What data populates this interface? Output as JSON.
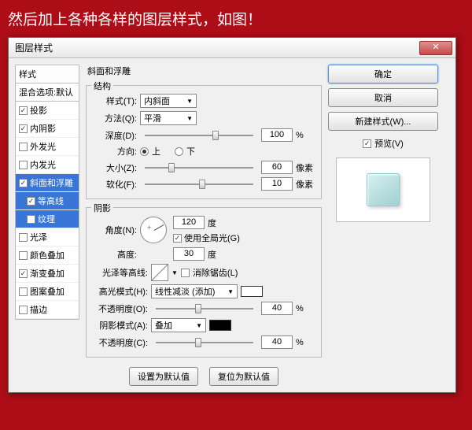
{
  "caption": "然后加上各种各样的图层样式，如图！",
  "dialog": {
    "title": "图层样式"
  },
  "left": {
    "styles_hdr": "样式",
    "blend_hdr": "混合选项:默认",
    "items": [
      {
        "label": "投影",
        "on": true
      },
      {
        "label": "内阴影",
        "on": true
      },
      {
        "label": "外发光",
        "on": false
      },
      {
        "label": "内发光",
        "on": false
      },
      {
        "label": "斜面和浮雕",
        "on": true,
        "sel": true
      },
      {
        "label": "等高线",
        "on": true,
        "sub": true,
        "sel": true
      },
      {
        "label": "纹理",
        "on": false,
        "sub": true,
        "sel": true
      },
      {
        "label": "光泽",
        "on": false
      },
      {
        "label": "颜色叠加",
        "on": false
      },
      {
        "label": "渐变叠加",
        "on": true
      },
      {
        "label": "图案叠加",
        "on": false
      },
      {
        "label": "描边",
        "on": false
      }
    ]
  },
  "bevel": {
    "group": "斜面和浮雕",
    "struct": "结构",
    "style_lbl": "样式(T):",
    "style_val": "内斜面",
    "tech_lbl": "方法(Q):",
    "tech_val": "平滑",
    "depth_lbl": "深度(D):",
    "depth_val": "100",
    "pct": "%",
    "dir_lbl": "方向:",
    "up": "上",
    "down": "下",
    "size_lbl": "大小(Z):",
    "size_val": "60",
    "px": "像素",
    "soft_lbl": "软化(F):",
    "soft_val": "10"
  },
  "shadow": {
    "group": "阴影",
    "angle_lbl": "角度(N):",
    "angle_val": "120",
    "deg": "度",
    "global": "使用全局光(G)",
    "alt_lbl": "高度:",
    "alt_val": "30",
    "gloss_lbl": "光泽等高线:",
    "anti": "消除锯齿(L)",
    "hmode_lbl": "高光模式(H):",
    "hmode_val": "线性减淡 (添加)",
    "hopac_lbl": "不透明度(O):",
    "hopac_val": "40",
    "smode_lbl": "阴影模式(A):",
    "smode_val": "叠加",
    "sopac_lbl": "不透明度(C):",
    "sopac_val": "40"
  },
  "footer": {
    "default": "设置为默认值",
    "reset": "复位为默认值"
  },
  "right": {
    "ok": "确定",
    "cancel": "取消",
    "new": "新建样式(W)...",
    "preview": "预览(V)"
  }
}
